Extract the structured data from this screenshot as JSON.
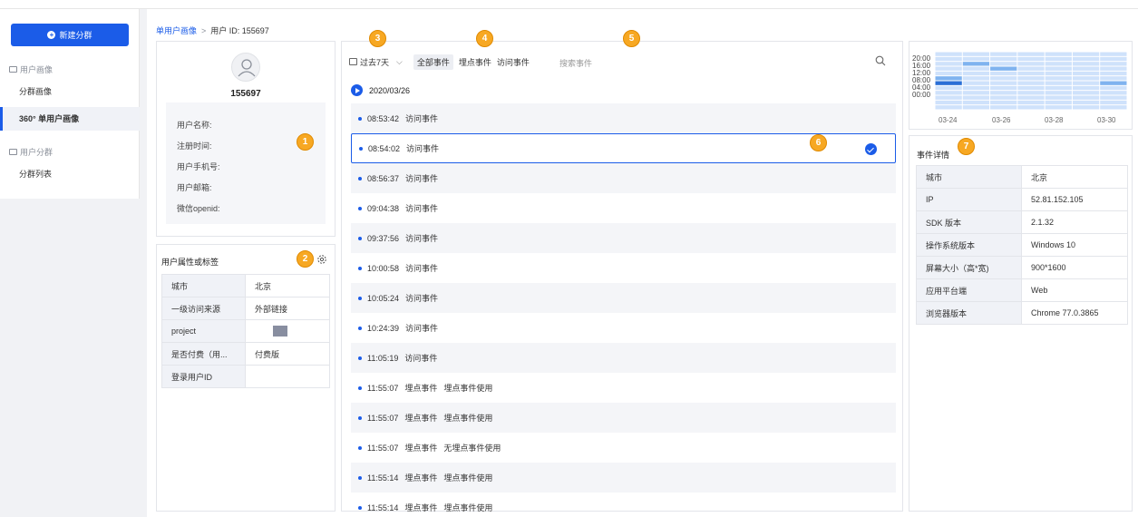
{
  "sidebar": {
    "new_button": "新建分群",
    "groups": [
      {
        "label": "用户画像",
        "items": [
          "分群画像",
          "360° 单用户画像"
        ]
      },
      {
        "label": "用户分群",
        "items": [
          "分群列表"
        ]
      }
    ]
  },
  "breadcrumb": {
    "parent": "单用户画像",
    "separator": ">",
    "current": "用户 ID: 155697"
  },
  "profile": {
    "user_id": "155697",
    "fields": [
      "用户名称:",
      "注册时间:",
      "用户手机号:",
      "用户邮箱:",
      "微信openid:"
    ]
  },
  "attributes": {
    "title": "用户属性或标签",
    "rows": [
      {
        "key": "城市",
        "value": "北京"
      },
      {
        "key": "一级访问来源",
        "value": "外部链接"
      },
      {
        "key": "project",
        "value": ""
      },
      {
        "key": "是否付费（用...",
        "value": "付费版"
      },
      {
        "key": "登录用户ID",
        "value": ""
      }
    ]
  },
  "events": {
    "date_range": "过去7天",
    "filters": [
      "全部事件",
      "埋点事件",
      "访问事件"
    ],
    "active_filter": "全部事件",
    "search_placeholder": "搜索事件",
    "date": "2020/03/26",
    "rows": [
      {
        "time": "08:53:42",
        "name": "访问事件",
        "extra": ""
      },
      {
        "time": "08:54:02",
        "name": "访问事件",
        "extra": "",
        "selected": true
      },
      {
        "time": "08:56:37",
        "name": "访问事件",
        "extra": ""
      },
      {
        "time": "09:04:38",
        "name": "访问事件",
        "extra": ""
      },
      {
        "time": "09:37:56",
        "name": "访问事件",
        "extra": ""
      },
      {
        "time": "10:00:58",
        "name": "访问事件",
        "extra": ""
      },
      {
        "time": "10:05:24",
        "name": "访问事件",
        "extra": ""
      },
      {
        "time": "10:24:39",
        "name": "访问事件",
        "extra": ""
      },
      {
        "time": "11:05:19",
        "name": "访问事件",
        "extra": ""
      },
      {
        "time": "11:55:07",
        "name": "埋点事件",
        "extra": "埋点事件使用"
      },
      {
        "time": "11:55:07",
        "name": "埋点事件",
        "extra": "埋点事件使用"
      },
      {
        "time": "11:55:07",
        "name": "埋点事件",
        "extra": "无埋点事件使用"
      },
      {
        "time": "11:55:14",
        "name": "埋点事件",
        "extra": "埋点事件使用"
      },
      {
        "time": "11:55:14",
        "name": "埋点事件",
        "extra": "埋点事件使用"
      }
    ]
  },
  "heatmap": {
    "y_labels": [
      "20:00",
      "16:00",
      "12:00",
      "08:00",
      "04:00",
      "00:00"
    ],
    "x_labels": [
      "03-24",
      "03-26",
      "03-28",
      "03-30"
    ],
    "columns": 7,
    "rows": 12,
    "colors": {
      "light": "#cfe2fb",
      "mid": "#7fb3ef",
      "dark": "#2a6fd6"
    },
    "intensity": [
      [
        0,
        0,
        0,
        0,
        0,
        0,
        0
      ],
      [
        0,
        1,
        0,
        0,
        0,
        0,
        1
      ],
      [
        0,
        2,
        1,
        0,
        0,
        0,
        0
      ],
      [
        0,
        0,
        2,
        0,
        0,
        0,
        0
      ],
      [
        0,
        0,
        0,
        0,
        0,
        0,
        0
      ],
      [
        2,
        0,
        0,
        0,
        0,
        0,
        1
      ],
      [
        3,
        1,
        0,
        0,
        0,
        0,
        2
      ],
      [
        0,
        0,
        0,
        0,
        0,
        0,
        0
      ],
      [
        0,
        0,
        0,
        0,
        0,
        0,
        0
      ],
      [
        0,
        0,
        0,
        0,
        0,
        0,
        0
      ],
      [
        0,
        0,
        0,
        0,
        0,
        0,
        0
      ],
      [
        0,
        0,
        0,
        0,
        0,
        0,
        0
      ]
    ]
  },
  "detail": {
    "title": "事件详情",
    "rows": [
      {
        "key": "城市",
        "value": "北京"
      },
      {
        "key": "IP",
        "value": "52.81.152.105"
      },
      {
        "key": "SDK 版本",
        "value": "2.1.32"
      },
      {
        "key": "操作系统版本",
        "value": "Windows 10"
      },
      {
        "key": "屏幕大小（高*宽)",
        "value": "900*1600"
      },
      {
        "key": "应用平台端",
        "value": "Web"
      },
      {
        "key": "浏览器版本",
        "value": "Chrome 77.0.3865"
      }
    ]
  },
  "badges": [
    "1",
    "2",
    "3",
    "4",
    "5",
    "6",
    "7"
  ],
  "accent_color": "#1b5ce8",
  "badge_color": "#f7a823"
}
